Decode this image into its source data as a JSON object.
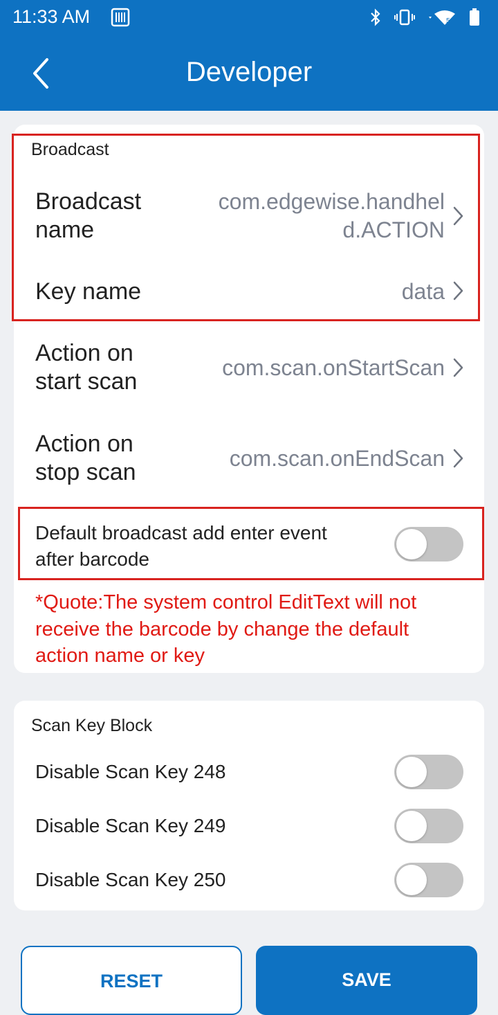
{
  "status_bar": {
    "time": "11:33 AM",
    "icons": [
      "barcode-icon",
      "bluetooth-icon",
      "vibrate-icon",
      "wifi-icon",
      "battery-icon"
    ]
  },
  "app_bar": {
    "title": "Developer",
    "back_icon": "chevron-left-icon"
  },
  "broadcast_section": {
    "label": "Broadcast",
    "rows": [
      {
        "label_line1": "Broadcast",
        "label_line2": "name",
        "value_line1": "com.edgewise.handhel",
        "value_line2": "d.ACTION"
      },
      {
        "label_line1": "Key name",
        "value_line1": "data"
      },
      {
        "label_line1": "Action on",
        "label_line2": "start scan",
        "value_line1": "com.scan.onStartScan"
      },
      {
        "label_line1": "Action on",
        "label_line2": "stop scan",
        "value_line1": "com.scan.onEndScan"
      }
    ],
    "enter_event": {
      "label_line1": "Default broadcast add enter event",
      "label_line2": "after barcode",
      "enabled": false
    },
    "quote_line1": "*Quote:The system control EditText will not",
    "quote_line2": "receive the barcode by change the default",
    "quote_line3": "action name or key"
  },
  "scan_key_block": {
    "label": "Scan Key Block",
    "items": [
      {
        "label": "Disable Scan Key 248",
        "enabled": false
      },
      {
        "label": "Disable Scan Key 249",
        "enabled": false
      },
      {
        "label": "Disable Scan Key 250",
        "enabled": false
      }
    ]
  },
  "buttons": {
    "reset": "RESET",
    "save": "SAVE"
  },
  "colors": {
    "primary": "#0e72c2",
    "highlight": "#d8231f",
    "warning_text": "#e01a14",
    "toggle_off": "#c4c4c4"
  }
}
